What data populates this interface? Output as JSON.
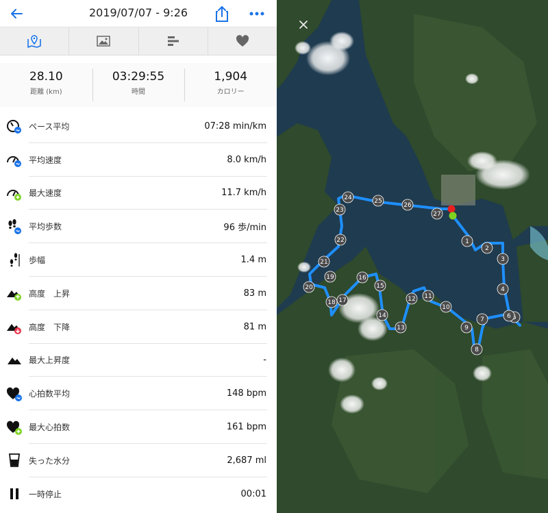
{
  "header": {
    "title": "2019/07/07 - 9:26",
    "back_icon": "arrow-left-icon",
    "share_icon": "share-icon",
    "more_icon": "more-dots-icon"
  },
  "tabs": [
    {
      "icon": "map-pin-icon",
      "active": true
    },
    {
      "icon": "image-icon",
      "active": false
    },
    {
      "icon": "bar-list-icon",
      "active": false
    },
    {
      "icon": "heart-icon",
      "active": false
    }
  ],
  "summary": [
    {
      "value": "28.10",
      "label": "距離 (km)"
    },
    {
      "value": "03:29:55",
      "label": "時間"
    },
    {
      "value": "1,904",
      "label": "カロリー"
    }
  ],
  "stats": [
    {
      "icon": "pace-icon",
      "label": "ペース平均",
      "value": "07:28 min/km"
    },
    {
      "icon": "speed-avg-icon",
      "label": "平均速度",
      "value": "8.0 km/h"
    },
    {
      "icon": "speed-max-icon",
      "label": "最大速度",
      "value": "11.7 km/h"
    },
    {
      "icon": "steps-icon",
      "label": "平均歩数",
      "value": "96 歩/min"
    },
    {
      "icon": "stride-icon",
      "label": "歩幅",
      "value": "1.4 m"
    },
    {
      "icon": "elevation-gain-icon",
      "label": "高度　上昇",
      "value": "83 m"
    },
    {
      "icon": "elevation-loss-icon",
      "label": "高度　下降",
      "value": "81 m"
    },
    {
      "icon": "elevation-max-icon",
      "label": "最大上昇度",
      "value": "-"
    },
    {
      "icon": "heart-rate-avg-icon",
      "label": "心拍数平均",
      "value": "148 bpm"
    },
    {
      "icon": "heart-rate-max-icon",
      "label": "最大心拍数",
      "value": "161 bpm"
    },
    {
      "icon": "water-loss-icon",
      "label": "失った水分",
      "value": "2,687 ml"
    },
    {
      "icon": "pause-icon",
      "label": "一時停止",
      "value": "00:01"
    }
  ],
  "map": {
    "close_label": "×",
    "route_color": "#1e8fff",
    "start_color": "#7ed321",
    "end_color": "#e82020",
    "km_markers": [
      "1",
      "2",
      "3",
      "4",
      "5",
      "6",
      "7",
      "8",
      "9",
      "10",
      "11",
      "12",
      "13",
      "14",
      "15",
      "16",
      "17",
      "18",
      "19",
      "20",
      "21",
      "22",
      "23",
      "24",
      "25",
      "26",
      "27"
    ]
  },
  "colors": {
    "accent": "#1a73e8",
    "plus_badge": "#7ed321",
    "minus_badge": "#e8334a"
  }
}
